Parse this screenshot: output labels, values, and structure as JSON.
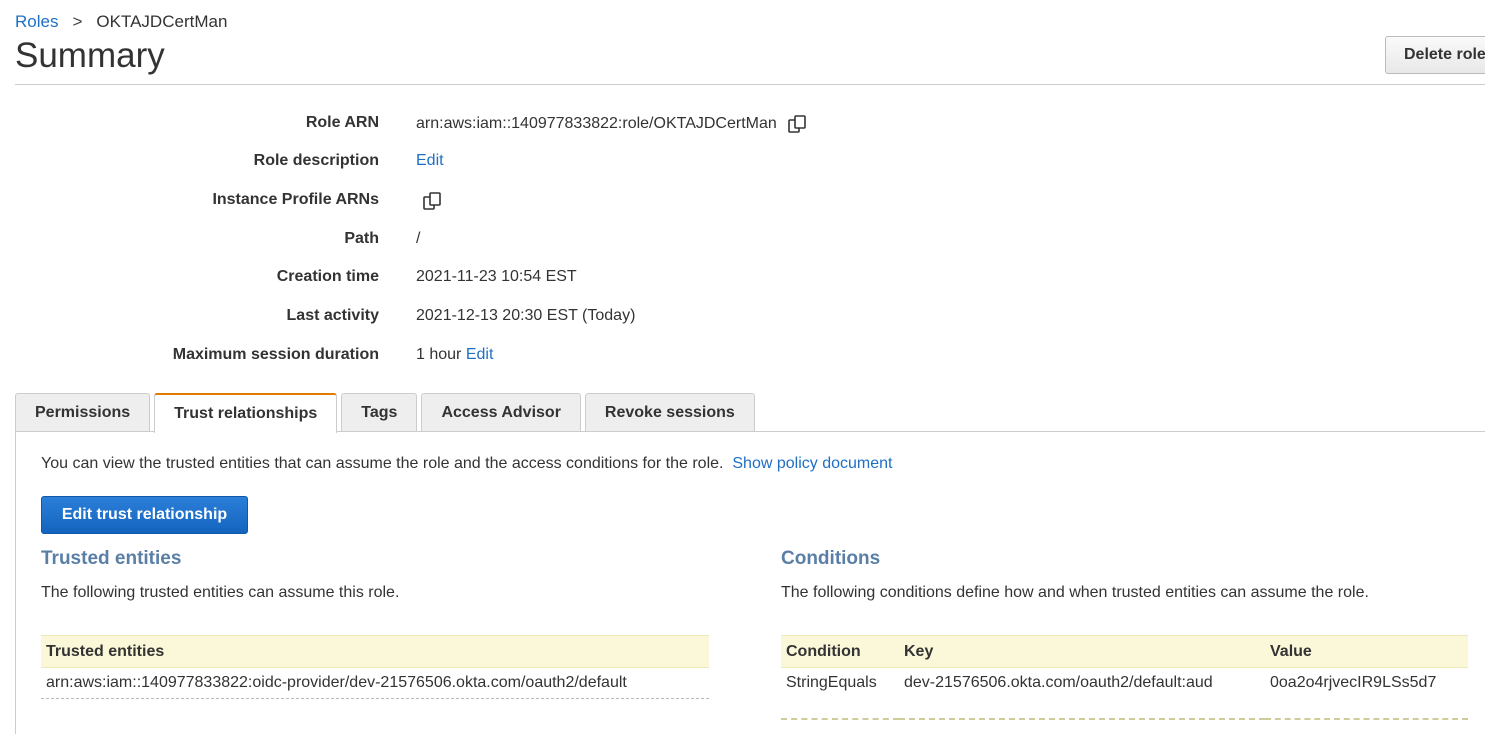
{
  "breadcrumb": {
    "parent": "Roles",
    "current": "OKTAJDCertMan"
  },
  "page_title": "Summary",
  "delete_button": "Delete role",
  "summary": {
    "role_arn": {
      "label": "Role ARN",
      "value": "arn:aws:iam::140977833822:role/OKTAJDCertMan"
    },
    "role_description": {
      "label": "Role description",
      "link": "Edit"
    },
    "instance_profile_arns": {
      "label": "Instance Profile ARNs"
    },
    "path": {
      "label": "Path",
      "value": "/"
    },
    "creation_time": {
      "label": "Creation time",
      "value": "2021-11-23 10:54 EST"
    },
    "last_activity": {
      "label": "Last activity",
      "value": "2021-12-13 20:30 EST (Today)"
    },
    "max_session": {
      "label": "Maximum session duration",
      "value": "1 hour",
      "link": "Edit"
    }
  },
  "tabs": [
    {
      "label": "Permissions"
    },
    {
      "label": "Trust relationships",
      "active": true
    },
    {
      "label": "Tags"
    },
    {
      "label": "Access Advisor"
    },
    {
      "label": "Revoke sessions"
    }
  ],
  "trust": {
    "intro": "You can view the trusted entities that can assume the role and the access conditions for the role.",
    "show_policy": "Show policy document",
    "edit_button": "Edit trust relationship",
    "entities": {
      "title": "Trusted entities",
      "desc": "The following trusted entities can assume this role.",
      "header": "Trusted entities",
      "rows": [
        "arn:aws:iam::140977833822:oidc-provider/dev-21576506.okta.com/oauth2/default"
      ]
    },
    "conditions": {
      "title": "Conditions",
      "desc": "The following conditions define how and when trusted entities can assume the role.",
      "headers": [
        "Condition",
        "Key",
        "Value"
      ],
      "rows": [
        [
          "StringEquals",
          "dev-21576506.okta.com/oauth2/default:aud",
          "0oa2o4rjvecIR9LSs5d7"
        ]
      ]
    }
  },
  "colors": {
    "link": "#1f6fc5",
    "active_tab": "#e07b00",
    "primary_button": "#1f6fc5",
    "table_header": "#faf8d8",
    "section_heading": "#5a7fa6"
  }
}
